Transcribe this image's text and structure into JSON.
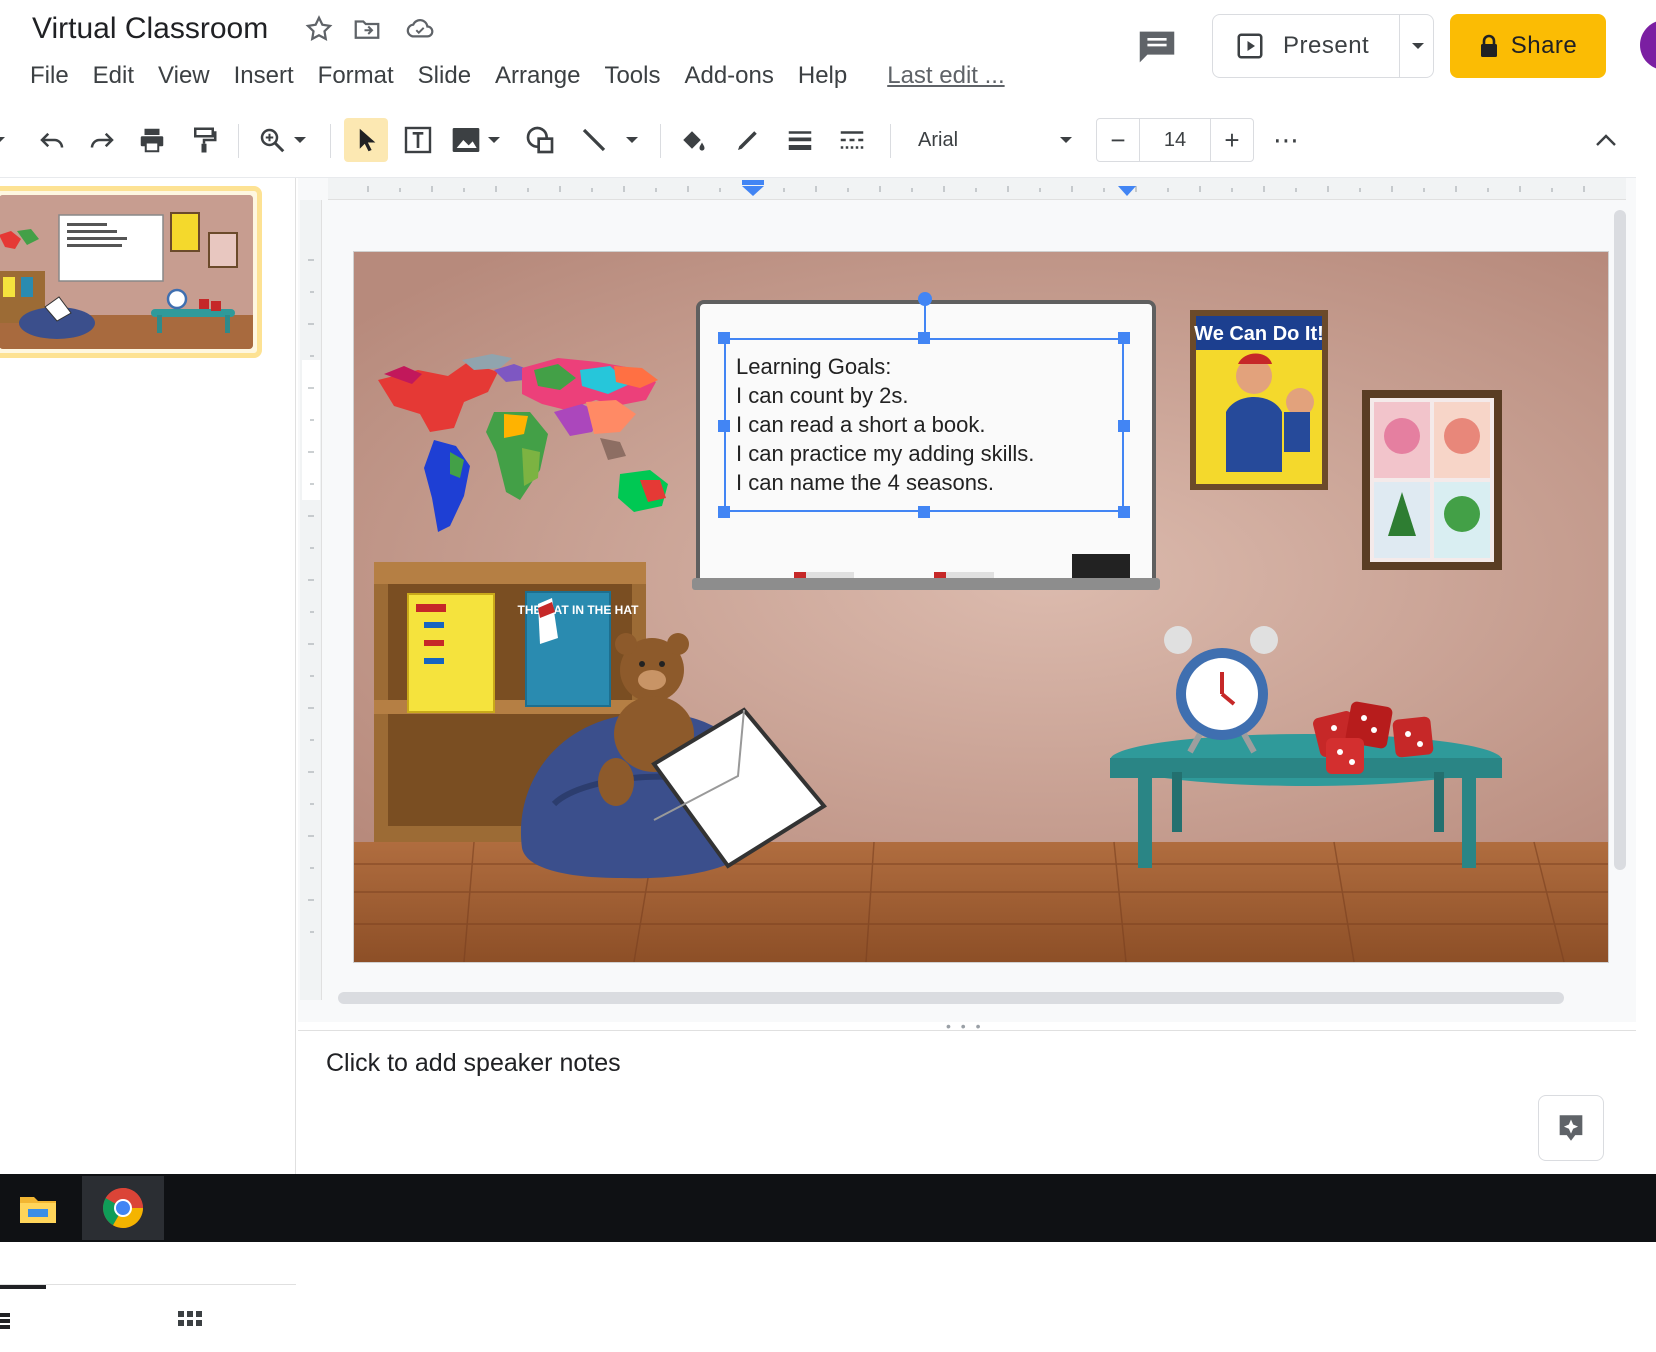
{
  "app": {
    "title": "Virtual Classroom",
    "title_icons": [
      "star-icon",
      "move-to-folder-icon",
      "cloud-saved-icon"
    ],
    "menu": [
      "File",
      "Edit",
      "View",
      "Insert",
      "Format",
      "Slide",
      "Arrange",
      "Tools",
      "Add-ons",
      "Help"
    ],
    "last_edit": "Last edit ...",
    "present_label": "Present",
    "share_label": "Share",
    "share_color": "#fbbc04",
    "avatar_color": "#7b1fa2"
  },
  "toolbar": {
    "font": "Arial",
    "font_size": "14",
    "minus": "−",
    "plus": "+",
    "more": "⋯"
  },
  "slide": {
    "whiteboard_lines": [
      "Learning Goals:",
      "I can count by 2s.",
      "I can read a short a book.",
      "I can practice my adding skills.",
      "I can name the 4 seasons."
    ],
    "poster_text": "We Can Do It!",
    "book_cover_text": "THE CAT IN THE HAT",
    "wall_color": "#c3998d",
    "floor_color": "#a6633a"
  },
  "notes": {
    "placeholder": "Click to add speaker notes"
  },
  "taskbar": {
    "apps": [
      "file-explorer-icon",
      "chrome-icon"
    ]
  }
}
